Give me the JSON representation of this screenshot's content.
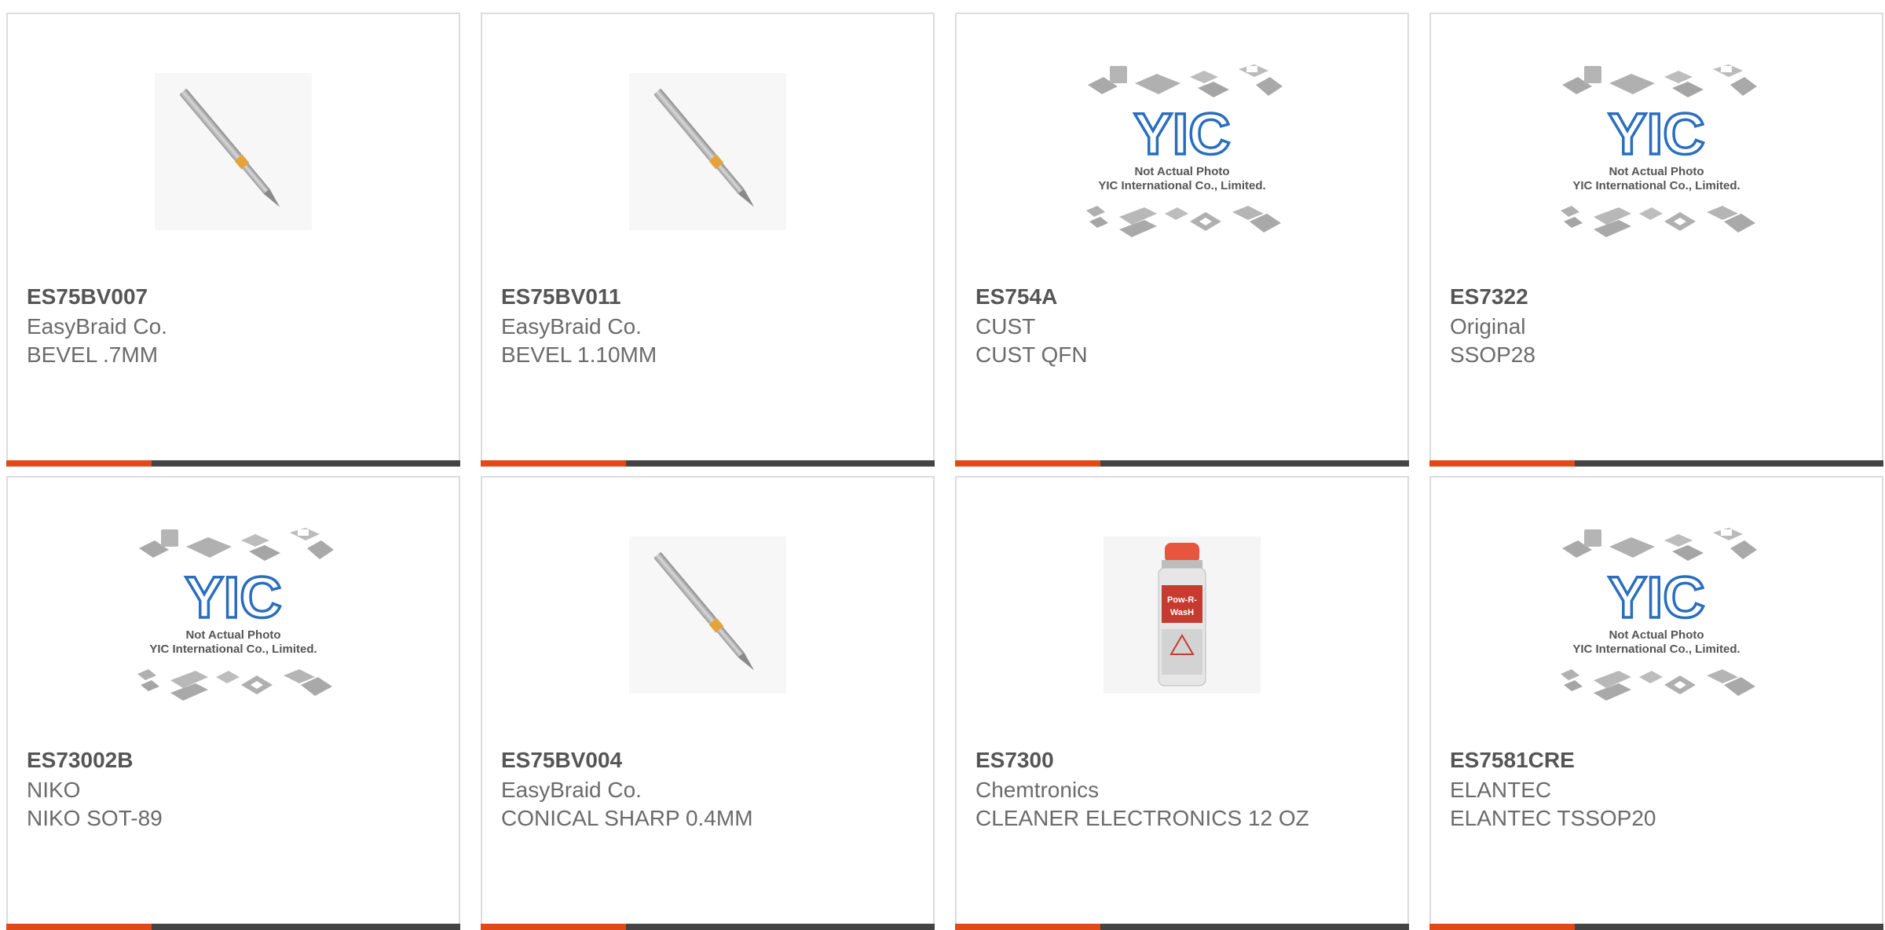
{
  "colors": {
    "accent": "#e04a15",
    "bar": "#444444",
    "border": "#dcdcdc",
    "yic_blue": "#2a6ebd"
  },
  "placeholder": {
    "line1": "Not Actual Photo",
    "line2": "YIC International Co., Limited.",
    "logo": "YIC"
  },
  "products": [
    {
      "part": "ES75BV007",
      "manufacturer": "EasyBraid Co.",
      "description": "BEVEL .7MM",
      "image": "soldering-tip-icon"
    },
    {
      "part": "ES75BV011",
      "manufacturer": "EasyBraid Co.",
      "description": "BEVEL 1.10MM",
      "image": "soldering-tip-icon"
    },
    {
      "part": "ES754A",
      "manufacturer": "CUST",
      "description": "CUST QFN",
      "image": "placeholder-photo"
    },
    {
      "part": "ES7322",
      "manufacturer": "Original",
      "description": "SSOP28",
      "image": "placeholder-photo"
    },
    {
      "part": "ES73002B",
      "manufacturer": "NIKO",
      "description": "NIKO SOT-89",
      "image": "placeholder-photo"
    },
    {
      "part": "ES75BV004",
      "manufacturer": "EasyBraid Co.",
      "description": "CONICAL SHARP 0.4MM",
      "image": "soldering-tip-icon"
    },
    {
      "part": "ES7300",
      "manufacturer": "Chemtronics",
      "description": "CLEANER ELECTRONICS 12 OZ",
      "image": "spray-can-icon"
    },
    {
      "part": "ES7581CRE",
      "manufacturer": "ELANTEC",
      "description": "ELANTEC TSSOP20",
      "image": "placeholder-photo"
    }
  ]
}
